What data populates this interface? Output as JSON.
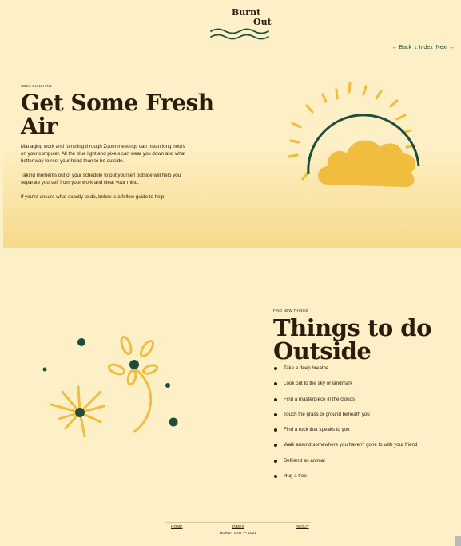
{
  "logo": {
    "line1": "Burnt",
    "line2": "Out"
  },
  "nav": {
    "back": "← Back",
    "index": "↓ Index",
    "next": "Next →"
  },
  "hero": {
    "eyebrow": "SEEK SUNSHINE",
    "title_line1": "Get Some Fresh",
    "title_line2": "Air",
    "p1_line1": "Managing work and fumbling through Zoom meetings can mean long hours",
    "p1_line2": "on your computer. All the blue light and pixels can wear you down and what",
    "p1_line3": "better way to rest your head than to be outside.",
    "p2_line1": "Taking moments out of your schedule to put yourself outside will help you",
    "p2_line2": "separate yourself from your work and clear your mind.",
    "p3": "If you're unsure what exactly to do, below is a fellow guide to help!"
  },
  "section2": {
    "eyebrow": "FIND NEW THINGS",
    "title_line1": "Things to do",
    "title_line2": "Outside",
    "items": [
      "Take a deep breathe",
      "Look out to the sky or landmark",
      "Find a masterpiece in the clouds",
      "Touch the grass or ground beneath you",
      "Find a rock that speaks to you",
      "Walk around somewhere you haven't gone to with your friend",
      "Befriend an animal",
      "Hug a tree"
    ]
  },
  "footer": {
    "home": "HOME",
    "index": "INDEX",
    "about": "ABOUT",
    "copy": "BURNT OUT — 2021"
  },
  "colors": {
    "accent_yellow": "#f0bd3f",
    "deep_green": "#1f4d3a",
    "text_brown": "#2b1d0e",
    "background": "#fef0c6"
  }
}
